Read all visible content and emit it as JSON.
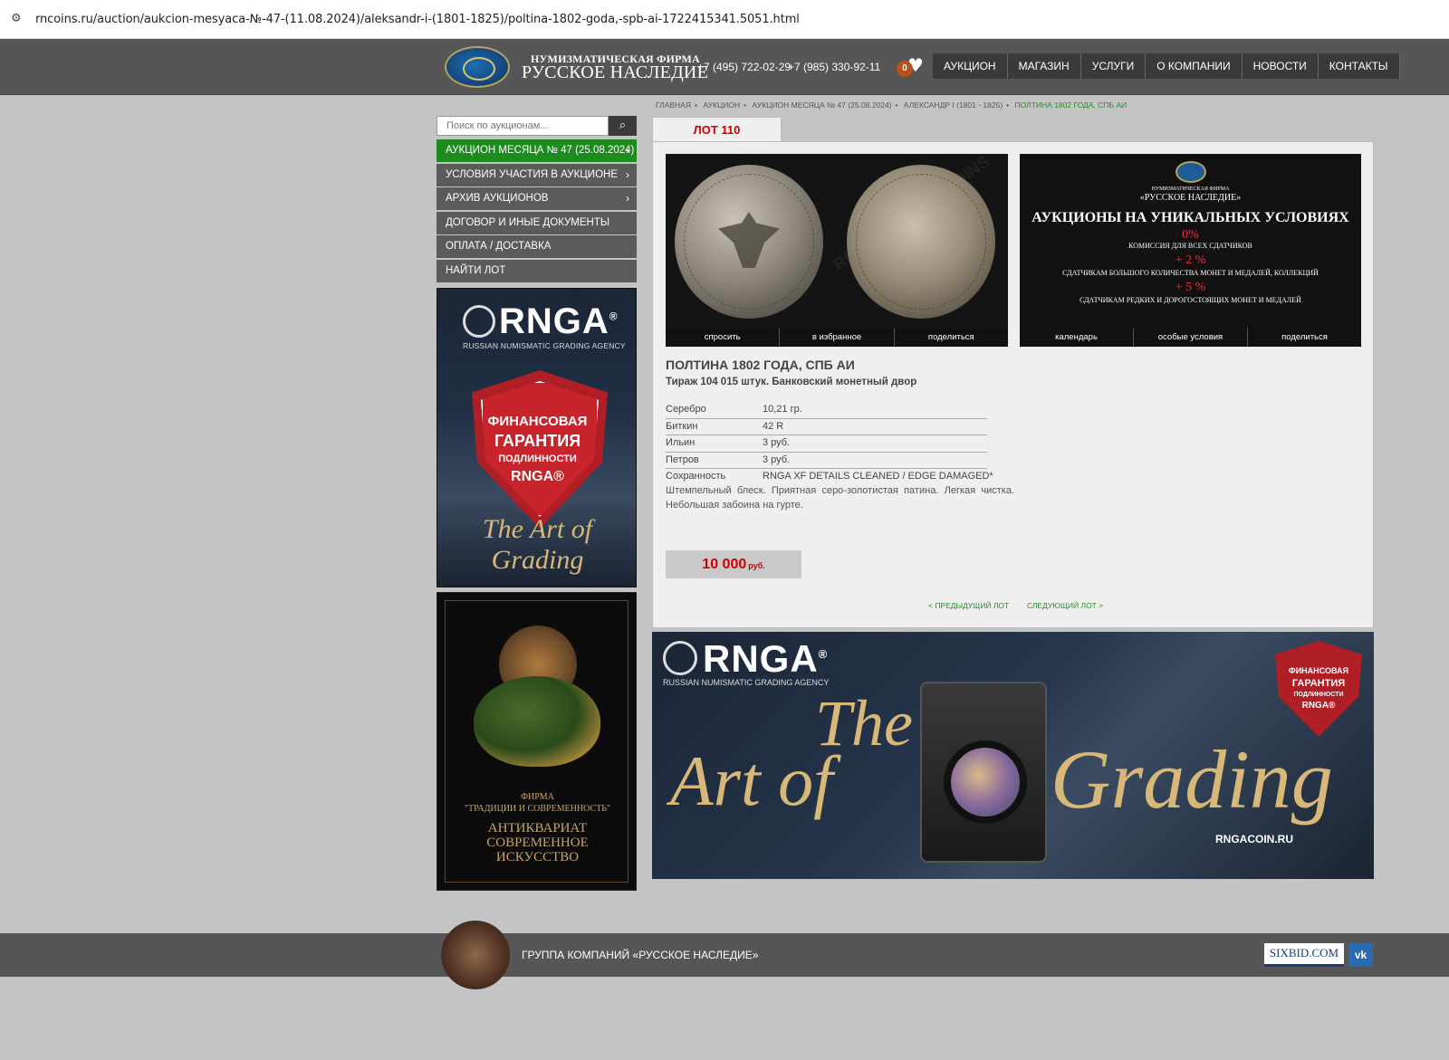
{
  "browser": {
    "url": "rncoins.ru/auction/aukcion-mesyaca-№-47-(11.08.2024)/aleksandr-i-(1801-1825)/poltina-1802-goda,-spb-ai-1722415341.5051.html"
  },
  "header": {
    "brand_top": "НУМИЗМАТИЧЕСКАЯ ФИРМА",
    "brand_main": "РУССКОЕ НАСЛЕДИЕ",
    "phone1": "+7 (495) 722-02-29",
    "phone2": "+7 (985) 330-92-11",
    "favorites_count": "0",
    "nav": [
      "АУКЦИОН",
      "МАГАЗИН",
      "УСЛУГИ",
      "О КОМПАНИИ",
      "НОВОСТИ",
      "КОНТАКТЫ"
    ]
  },
  "sidebar": {
    "search_placeholder": "Поиск по аукционам...",
    "menu": [
      {
        "label": "АУКЦИОН МЕСЯЦА № 47 (25.08.2024)",
        "chevron": "›"
      },
      {
        "label": "УСЛОВИЯ УЧАСТИЯ В АУКЦИОНЕ",
        "chevron": "›"
      },
      {
        "label": "АРХИВ АУКЦИОНОВ",
        "chevron": "›"
      },
      {
        "label": "ДОГОВОР И ИНЫЕ ДОКУМЕНТЫ",
        "chevron": ""
      },
      {
        "label": "ОПЛАТА / ДОСТАВКА",
        "chevron": ""
      },
      {
        "label": "НАЙТИ ЛОТ",
        "chevron": ""
      }
    ],
    "ad_rnga": {
      "brand": "RNGA",
      "reg": "®",
      "sub": "RUSSIAN NUMISMATIC GRADING AGENCY",
      "shield_lines": [
        "ФИНАНСОВАЯ",
        "ГАРАНТИЯ",
        "ПОДЛИННОСТИ",
        "RNGA®"
      ],
      "script": "The Art of Grading"
    },
    "ad_antique": {
      "firm": "ФИРМА",
      "firm_name": "\"ТРАДИЦИИ И СОВРЕМЕННОСТЬ\"",
      "lines": [
        "АНТИКВАРИАТ",
        "СОВРЕМЕННОЕ",
        "ИСКУССТВО"
      ]
    }
  },
  "breadcrumbs": [
    "ГЛАВНАЯ",
    "АУКЦИОН",
    "АУКЦИОН МЕСЯЦА № 47 (25.08.2024)",
    "АЛЕКСАНДР I (1801 - 1825)",
    "ПОЛТИНА 1802 ГОДА, СПБ АИ"
  ],
  "lot": {
    "tab": "ЛОТ 110",
    "photo_actions": [
      "спросить",
      "в избранное",
      "поделиться"
    ],
    "title": "ПОЛТИНА 1802 ГОДА, СПБ АИ",
    "subtitle": "Тираж 104 015 штук. Банковский монетный двор",
    "specs": [
      {
        "k": "Серебро",
        "v": "10,21 гр."
      },
      {
        "k": "Биткин",
        "v": "42 R"
      },
      {
        "k": "Ильин",
        "v": "3 руб."
      },
      {
        "k": "Петров",
        "v": "3 руб."
      },
      {
        "k": "Сохранность",
        "v": "RNGA XF DETAILS CLEANED / EDGE DAMAGED*"
      }
    ],
    "description": "Штемпельный блеск. Приятная серо-золотистая патина. Легкая чистка. Небольшая забоина на гурте.",
    "price": "10 000",
    "currency": "руб.",
    "prev": "< ПРЕДЫДУЩИЙ ЛОТ",
    "next": "СЛЕДУЮЩИЙ ЛОТ >"
  },
  "promo": {
    "firm": "НУМИЗМАТИЧЕСКАЯ ФИРМА",
    "name": "«РУССКОЕ НАСЛЕДИЕ»",
    "headline": "АУКЦИОНЫ НА УНИКАЛЬНЫХ УСЛОВИЯХ",
    "p1": "0%",
    "l1": "КОМИССИЯ ДЛЯ ВСЕХ СДАТЧИКОВ",
    "p2": "+ 2 %",
    "l2": "СДАТЧИКАМ БОЛЬШОГО КОЛИЧЕСТВА МОНЕТ И МЕДАЛЕЙ, КОЛЛЕКЦИЙ",
    "p3": "+ 5 %",
    "l3": "СДАТЧИКАМ РЕДКИХ И ДОРОГОСТОЯЩИХ МОНЕТ И МЕДАЛЕЙ",
    "actions": [
      "календарь",
      "особые условия",
      "поделиться"
    ]
  },
  "banner": {
    "brand": "RNGA",
    "reg": "®",
    "sub": "RUSSIAN NUMISMATIC GRADING AGENCY",
    "script_the": "The",
    "script_art": "Art of",
    "script_grading": "Grading",
    "site": "RNGACOIN.RU",
    "shield_lines": [
      "ФИНАНСОВАЯ",
      "ГАРАНТИЯ",
      "ПОДЛИННОСТИ",
      "RNGA®"
    ]
  },
  "footer": {
    "text": "ГРУППА КОМПАНИЙ «РУССКОЕ НАСЛЕДИЕ»",
    "sixbid": "SIXBID.COM",
    "vk": "vk"
  },
  "colors": {
    "accent_green": "#1e8b1e",
    "price_red": "#cc0000",
    "header_bg": "#565656"
  }
}
